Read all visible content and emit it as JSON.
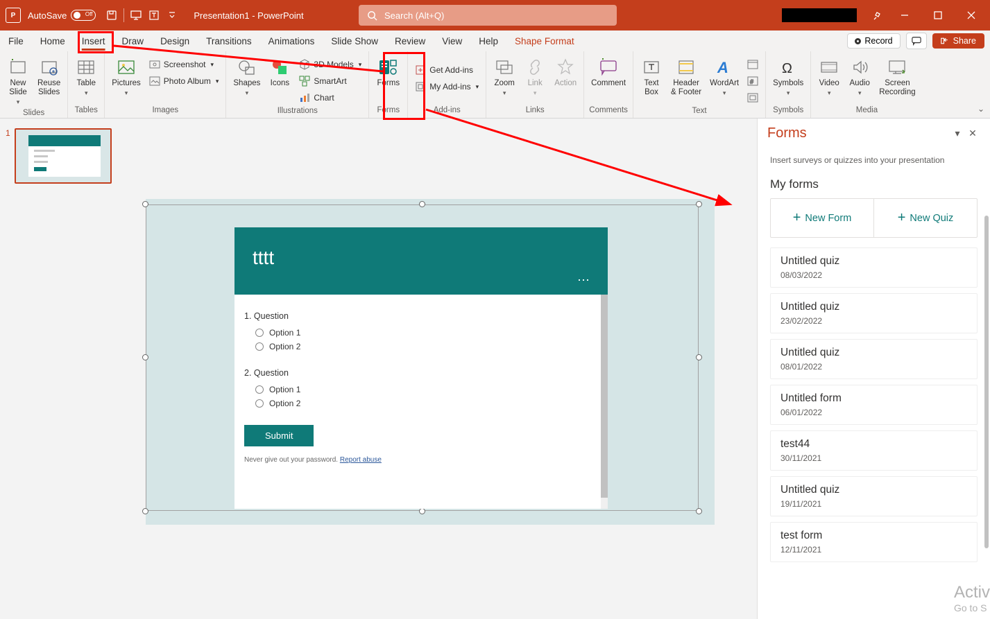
{
  "titlebar": {
    "autosave_label": "AutoSave",
    "autosave_state": "Off",
    "doc_title": "Presentation1 - PowerPoint",
    "search_placeholder": "Search (Alt+Q)"
  },
  "tabs": {
    "file": "File",
    "home": "Home",
    "insert": "Insert",
    "draw": "Draw",
    "design": "Design",
    "transitions": "Transitions",
    "animations": "Animations",
    "slideshow": "Slide Show",
    "review": "Review",
    "view": "View",
    "help": "Help",
    "shape_format": "Shape Format",
    "record": "Record",
    "share": "Share"
  },
  "ribbon": {
    "slides": {
      "label": "Slides",
      "new_slide": "New\nSlide",
      "reuse_slides": "Reuse\nSlides"
    },
    "tables": {
      "label": "Tables",
      "table": "Table"
    },
    "images": {
      "label": "Images",
      "pictures": "Pictures",
      "screenshot": "Screenshot",
      "photo_album": "Photo Album"
    },
    "illustrations": {
      "label": "Illustrations",
      "shapes": "Shapes",
      "icons": "Icons",
      "models": "3D Models",
      "smartart": "SmartArt",
      "chart": "Chart"
    },
    "forms": {
      "label": "Forms",
      "forms": "Forms"
    },
    "addins": {
      "label": "Add-ins",
      "get": "Get Add-ins",
      "my": "My Add-ins"
    },
    "links": {
      "label": "Links",
      "zoom": "Zoom",
      "link": "Link",
      "action": "Action"
    },
    "comments": {
      "label": "Comments",
      "comment": "Comment"
    },
    "text": {
      "label": "Text",
      "textbox": "Text\nBox",
      "header": "Header\n& Footer",
      "wordart": "WordArt"
    },
    "symbols": {
      "label": "Symbols",
      "symbols": "Symbols"
    },
    "media": {
      "label": "Media",
      "video": "Video",
      "audio": "Audio",
      "screenrec": "Screen\nRecording"
    }
  },
  "slide_thumb": {
    "number": "1"
  },
  "embedded_form": {
    "title": "tttt",
    "q1": {
      "title": "1. Question",
      "opt1": "Option 1",
      "opt2": "Option 2"
    },
    "q2": {
      "title": "2. Question",
      "opt1": "Option 1",
      "opt2": "Option 2"
    },
    "submit": "Submit",
    "disclaimer_text": "Never give out your password. ",
    "disclaimer_link": "Report abuse"
  },
  "forms_pane": {
    "title": "Forms",
    "description": "Insert surveys or quizzes into your presentation",
    "my_forms": "My forms",
    "new_form": "New Form",
    "new_quiz": "New Quiz",
    "items": [
      {
        "title": "Untitled quiz",
        "date": "08/03/2022"
      },
      {
        "title": "Untitled quiz",
        "date": "23/02/2022"
      },
      {
        "title": "Untitled quiz",
        "date": "08/01/2022"
      },
      {
        "title": "Untitled form",
        "date": "06/01/2022"
      },
      {
        "title": "test44",
        "date": "30/11/2021"
      },
      {
        "title": "Untitled quiz",
        "date": "19/11/2021"
      },
      {
        "title": "test form",
        "date": "12/11/2021"
      }
    ]
  },
  "watermark": {
    "line1": "Activ",
    "line2": "Go to S"
  }
}
